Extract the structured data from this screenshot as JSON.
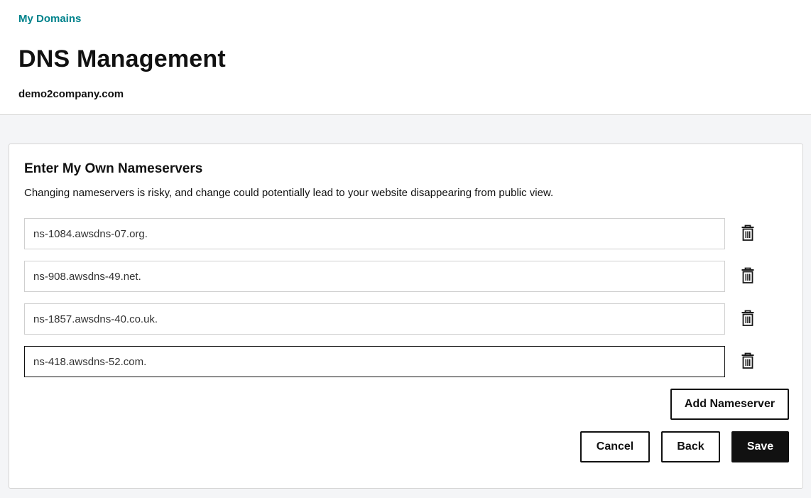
{
  "header": {
    "breadcrumb": "My Domains",
    "title": "DNS Management",
    "domain": "demo2company.com"
  },
  "card": {
    "title": "Enter My Own Nameservers",
    "description": "Changing nameservers is risky, and change could potentially lead to your website disappearing from public view.",
    "nameservers": [
      "ns-1084.awsdns-07.org.",
      "ns-908.awsdns-49.net.",
      "ns-1857.awsdns-40.co.uk.",
      "ns-418.awsdns-52.com."
    ],
    "focused_nameserver_index": 3,
    "delete_icon": "trash-icon",
    "add_label": "Add Nameserver",
    "cancel_label": "Cancel",
    "back_label": "Back",
    "save_label": "Save"
  },
  "colors": {
    "accent": "#00838c",
    "primary_button": "#111111",
    "page_background": "#f4f5f7"
  }
}
